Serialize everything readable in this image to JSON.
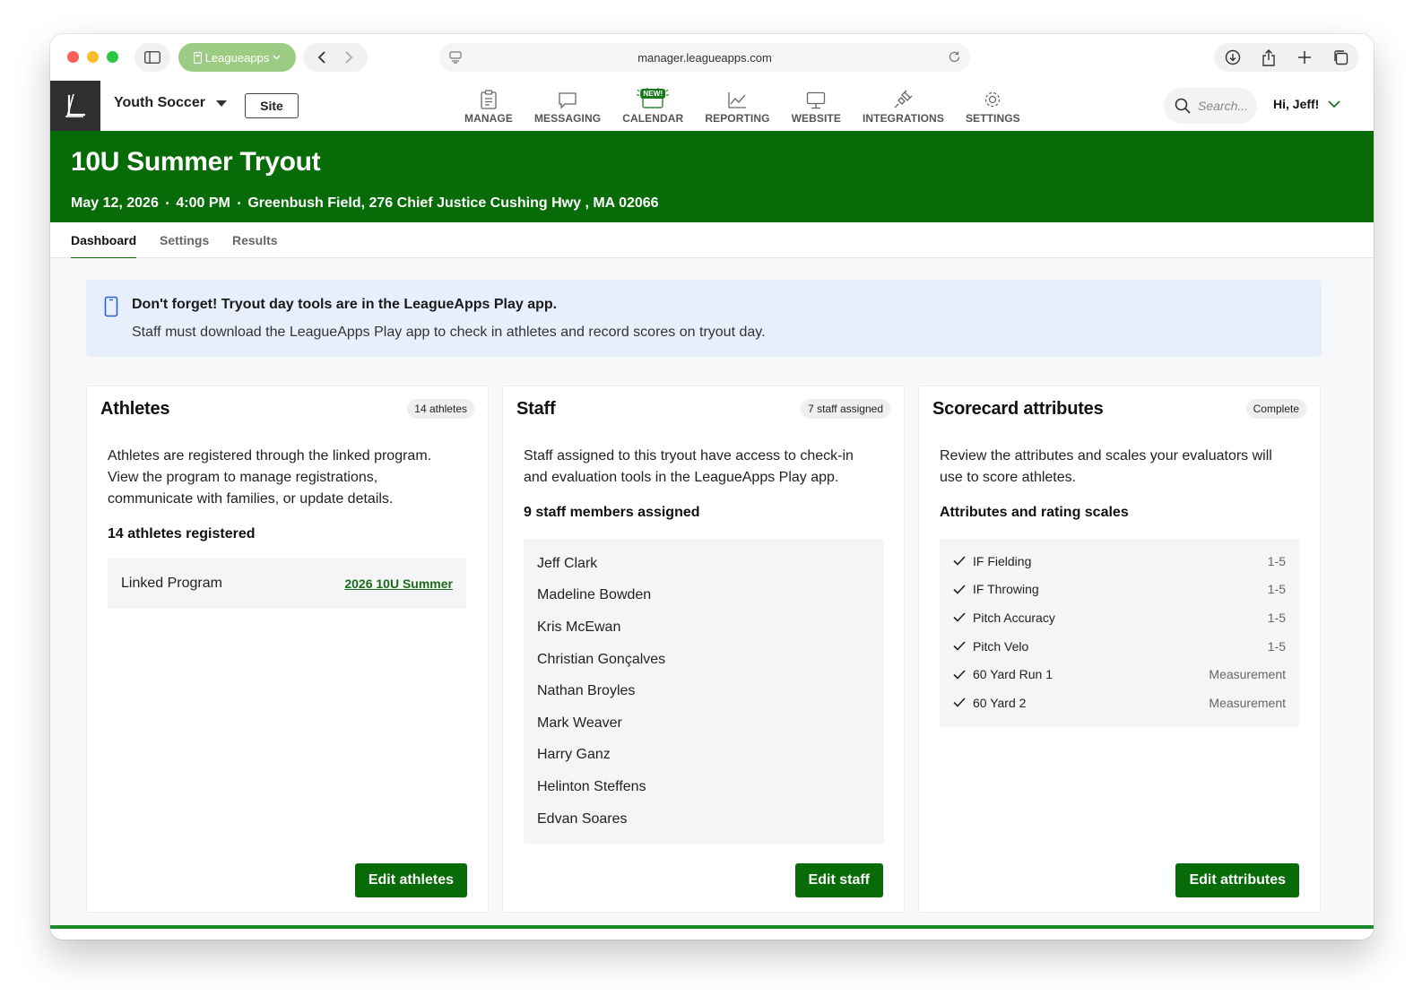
{
  "browser": {
    "profile_label": "Leagueapps",
    "url": "manager.leagueapps.com"
  },
  "header": {
    "org_name": "Youth Soccer",
    "site_label": "Site",
    "nav": [
      {
        "label": "MANAGE",
        "icon": "clipboard-icon"
      },
      {
        "label": "MESSAGING",
        "icon": "chat-icon"
      },
      {
        "label": "CALENDAR",
        "icon": "calendar-icon",
        "badge": "NEW!"
      },
      {
        "label": "REPORTING",
        "icon": "chart-icon"
      },
      {
        "label": "WEBSITE",
        "icon": "monitor-icon"
      },
      {
        "label": "INTEGRATIONS",
        "icon": "plug-icon"
      },
      {
        "label": "SETTINGS",
        "icon": "gear-icon"
      }
    ],
    "search_placeholder": "Search...",
    "greeting": "Hi, Jeff!"
  },
  "event": {
    "title": "10U Summer Tryout",
    "date": "May 12, 2026",
    "time": "4:00 PM",
    "location": "Greenbush Field, 276 Chief Justice Cushing Hwy , MA 02066"
  },
  "tabs": [
    "Dashboard",
    "Settings",
    "Results"
  ],
  "active_tab": "Dashboard",
  "notice": {
    "title": "Don't forget! Tryout day tools are in the LeagueApps Play app.",
    "body": "Staff must download the LeagueApps Play app to check in athletes and record scores on tryout day."
  },
  "athletes": {
    "title": "Athletes",
    "badge": "14 athletes",
    "description": "Athletes are registered through the linked program. View the program to manage registrations, communicate with families, or update details.",
    "count_label": "14 athletes registered",
    "linked_label": "Linked Program",
    "linked_value": "2026 10U Summer",
    "button": "Edit athletes"
  },
  "staff": {
    "title": "Staff",
    "badge": "7 staff assigned",
    "description": "Staff assigned to this tryout have access to check-in and evaluation tools in the LeagueApps Play app.",
    "count_label": "9 staff members assigned",
    "members": [
      "Jeff Clark",
      "Madeline Bowden",
      "Kris McEwan",
      "Christian Gonçalves",
      "Nathan Broyles",
      "Mark Weaver",
      "Harry Ganz",
      "Helinton Steffens",
      "Edvan Soares"
    ],
    "button": "Edit staff"
  },
  "scorecard": {
    "title": "Scorecard attributes",
    "badge": "Complete",
    "description": "Review the attributes and scales your evaluators will use to score athletes.",
    "subhead": "Attributes and rating scales",
    "attributes": [
      {
        "name": "IF Fielding",
        "scale": "1-5"
      },
      {
        "name": "IF Throwing",
        "scale": "1-5"
      },
      {
        "name": "Pitch Accuracy",
        "scale": "1-5"
      },
      {
        "name": "Pitch Velo",
        "scale": "1-5"
      },
      {
        "name": "60 Yard Run 1",
        "scale": "Measurement"
      },
      {
        "name": "60 Yard 2",
        "scale": "Measurement"
      }
    ],
    "button": "Edit attributes"
  },
  "colors": {
    "brand_green": "#076b07",
    "notice_bg": "#e8effc"
  }
}
